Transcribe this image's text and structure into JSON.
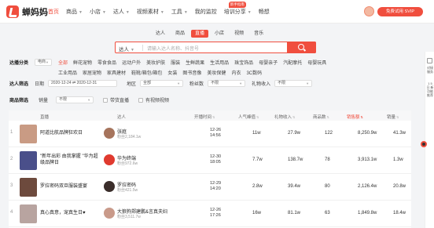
{
  "brand": {
    "name": "蝉妈妈",
    "accent": "#f04e3e"
  },
  "nav": [
    {
      "label": "首页",
      "active": true
    },
    {
      "label": "商品",
      "caret": true
    },
    {
      "label": "小店",
      "caret": true
    },
    {
      "label": "达人",
      "caret": true
    },
    {
      "label": "视频素材",
      "caret": true
    },
    {
      "label": "工具",
      "caret": true
    },
    {
      "label": "我的监控"
    },
    {
      "label": "培训分享",
      "caret": true,
      "badge": "新手指南"
    },
    {
      "label": "畅想"
    }
  ],
  "header_right": {
    "vip_label": "免费试用 SVIP"
  },
  "search_tabs": [
    {
      "label": "达人"
    },
    {
      "label": "商品"
    },
    {
      "label": "直播",
      "active": true
    },
    {
      "label": "小店"
    },
    {
      "label": "视频"
    },
    {
      "label": "音乐"
    }
  ],
  "search": {
    "type_label": "达人",
    "placeholder": "请输入达人名称、抖音号"
  },
  "filters": {
    "category_label": "达播分类",
    "category_select": "电商",
    "categories_row1": [
      "全部",
      "鲜花宠物",
      "零食食品",
      "运动户外",
      "美妆护肤",
      "服装",
      "生鲜蔬果",
      "生活用品",
      "珠宝饰品",
      "母婴亲子",
      "汽配摩托",
      "母婴玩具"
    ],
    "categories_row2": [
      "工业用品",
      "家居宠物",
      "家具建材",
      "鞋靴/箱包/箱包",
      "女装",
      "图书音像",
      "美妆保健",
      "内衣",
      "3C数码"
    ],
    "date_row_label": "达人筛选",
    "date_label": "日期",
    "date_range": "2020-12-24 ⇄ 2020-12-31",
    "region_label": "地区",
    "region_value": "全部",
    "fans_label": "粉丝数",
    "fans_value": "不限",
    "gmv_label": "礼物收入",
    "gmv_value": "不限",
    "product_row_label": "商品筛选",
    "sales_label": "销量",
    "sales_value": "不限",
    "check1": "带货直播",
    "check2": "有视频视频"
  },
  "table": {
    "headers": {
      "live": "直播",
      "anchor": "达人",
      "start": "开播时间",
      "peak": "人气峰值",
      "gift": "礼物收入",
      "goods": "商品数",
      "sales": "销售额",
      "volume": "销量"
    },
    "rows": [
      {
        "rank": "1",
        "title": "阿道比航品牌狂欢日",
        "anchor": "张庭",
        "fans": "粉丝2,184.1w",
        "date": "12-26",
        "time": "14:56",
        "peak": "11w",
        "gift": "27.9w",
        "goods": "122",
        "sales": "8,250.9w",
        "volume": "41.3w",
        "thumb": "#c99b84",
        "ava": "#a6745c"
      },
      {
        "rank": "2",
        "title": "\"新年出彩 由我掌握 \"华为超级品牌日",
        "anchor": "华为终端",
        "fans": "粉丝972.6w",
        "date": "12-30",
        "time": "18:05",
        "peak": "7.7w",
        "gift": "138.7w",
        "goods": "78",
        "sales": "3,913.1w",
        "volume": "1.3w",
        "thumb": "#4a4f8a",
        "ava": "#e03a2f"
      },
      {
        "rank": "3",
        "title": "罗拉密码双旦服装盛宴",
        "anchor": "罗拉密码",
        "fans": "粉丝421.5w",
        "date": "12-29",
        "time": "14:20",
        "peak": "2.8w",
        "gift": "39.4w",
        "goods": "80",
        "sales": "2,126.4w",
        "volume": "20.8w",
        "thumb": "#6d4a3d",
        "ava": "#3a2d2a"
      },
      {
        "rank": "4",
        "title": "真心真意，宠真生日♥",
        "anchor": "大狼狗郑建鹏&言真夫妇",
        "fans": "粉丝3,511.7w",
        "date": "12-26",
        "time": "17:26",
        "peak": "16w",
        "gift": "81.1w",
        "goods": "63",
        "sales": "1,849.8w",
        "volume": "18.4w",
        "thumb": "#b8a4a0",
        "ava": "#c99a8a"
      }
    ]
  },
  "right_rail": {
    "item1": "对接服务",
    "item2": "1 5 日 新功能推荐"
  }
}
